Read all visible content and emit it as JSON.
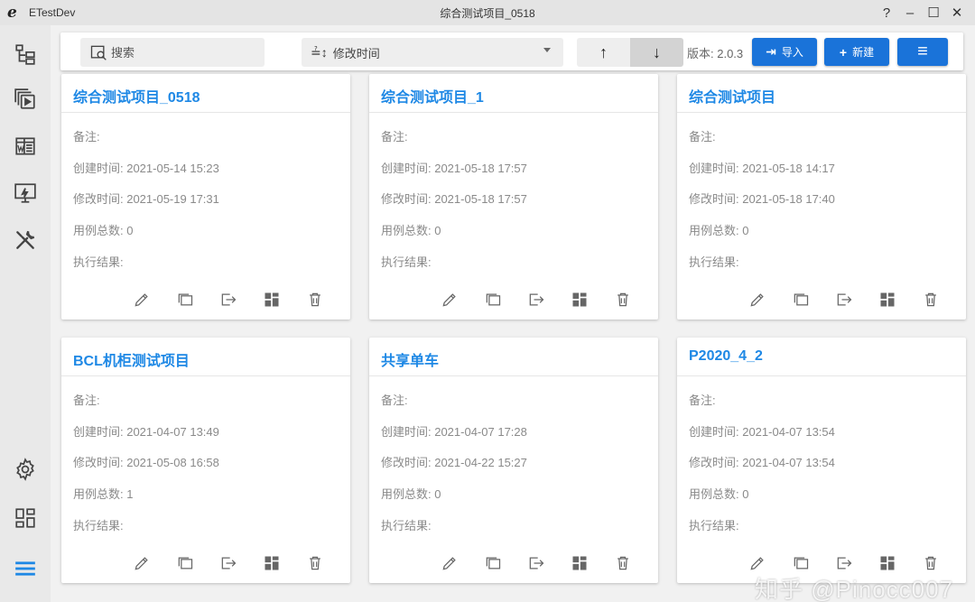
{
  "window": {
    "app_name": "ETestDev",
    "title": "综合测试项目_0518",
    "help": "?",
    "minimize": "–",
    "maximize": "☐",
    "close": "✕"
  },
  "sidebar": {
    "top_items": [
      "tree-icon",
      "media-icon",
      "document-icon",
      "monitor-icon",
      "tools-icon"
    ],
    "bottom_items": [
      "gear-icon",
      "dashboard-icon",
      "list-icon"
    ],
    "active_item": "list-icon",
    "active_color": "#1e88e5"
  },
  "toolbar": {
    "search_placeholder": "搜索",
    "sort_icon": "≟↕",
    "sort_value": "修改时间",
    "asc_label": "↑",
    "desc_label": "↓",
    "active_direction": "desc",
    "version": "版本: 2.0.3",
    "import_icon": "⇥",
    "import_label": "导入",
    "new_icon": "+",
    "new_label": "新建",
    "menu_icon": "≡"
  },
  "colors": {
    "accent": "#1a73d9",
    "title_blue": "#1e88e5"
  },
  "projects": [
    {
      "name": "综合测试项目_0518",
      "note": "备注:",
      "created": "创建时间: 2021-05-14 15:23",
      "modified": "修改时间: 2021-05-19 17:31",
      "case_count": "用例总数: 0",
      "result": "执行结果:"
    },
    {
      "name": "综合测试项目_1",
      "note": "备注:",
      "created": "创建时间: 2021-05-18 17:57",
      "modified": "修改时间: 2021-05-18 17:57",
      "case_count": "用例总数: 0",
      "result": "执行结果:"
    },
    {
      "name": "综合测试项目",
      "note": "备注:",
      "created": "创建时间: 2021-05-18 14:17",
      "modified": "修改时间: 2021-05-18 17:40",
      "case_count": "用例总数: 0",
      "result": "执行结果:"
    },
    {
      "name": "BCL机柜测试项目",
      "note": "备注:",
      "created": "创建时间: 2021-04-07 13:49",
      "modified": "修改时间: 2021-05-08 16:58",
      "case_count": "用例总数: 1",
      "result": "执行结果:"
    },
    {
      "name": "共享单车",
      "note": "备注:",
      "created": "创建时间: 2021-04-07 17:28",
      "modified": "修改时间: 2021-04-22 15:27",
      "case_count": "用例总数: 0",
      "result": "执行结果:"
    },
    {
      "name": "P2020_4_2",
      "note": "备注:",
      "created": "创建时间: 2021-04-07 13:54",
      "modified": "修改时间: 2021-04-07 13:54",
      "case_count": "用例总数: 0",
      "result": "执行结果:"
    }
  ],
  "card_actions": [
    "edit-icon",
    "copy-icon",
    "export-icon",
    "dashboard-icon",
    "delete-icon"
  ],
  "watermark": "知乎 @Pinocc007"
}
